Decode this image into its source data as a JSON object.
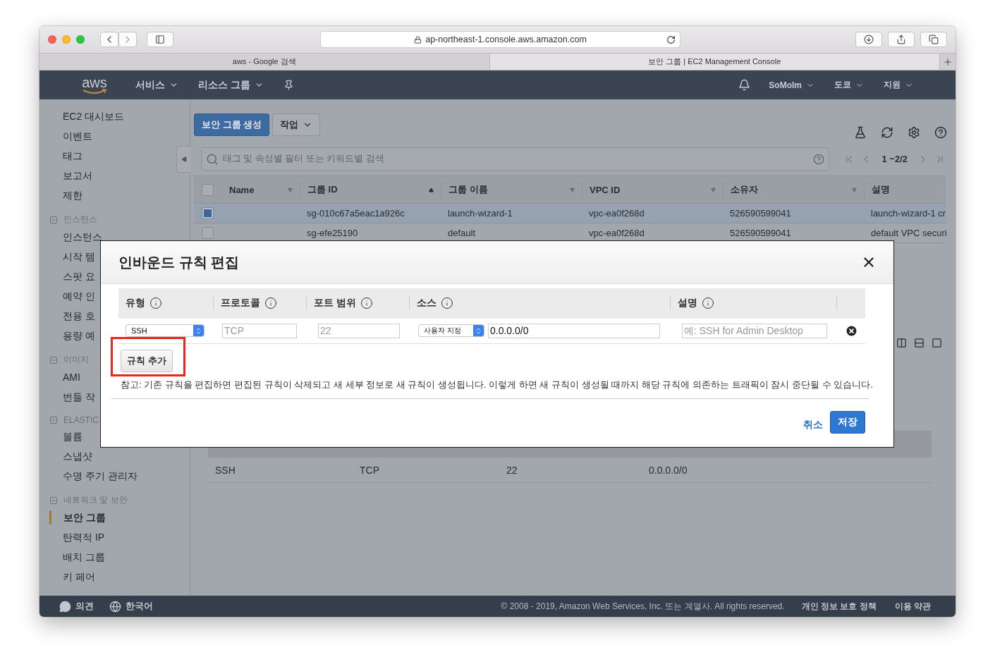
{
  "browser": {
    "url": "ap-northeast-1.console.aws.amazon.com",
    "tabs": [
      {
        "label": "aws - Google 검색",
        "selected": false
      },
      {
        "label": "보안 그룹 | EC2 Management Console",
        "selected": true
      }
    ]
  },
  "navbar": {
    "logo": "aws",
    "menus": [
      "서비스",
      "리소스 그룹"
    ],
    "user": "SoMoIm",
    "region": "도쿄",
    "support": "지원"
  },
  "sidebar": {
    "items": [
      {
        "kind": "link",
        "label": "EC2 대시보드",
        "selected": false
      },
      {
        "kind": "link",
        "label": "이벤트",
        "selected": false
      },
      {
        "kind": "link",
        "label": "태그",
        "selected": false
      },
      {
        "kind": "link",
        "label": "보고서",
        "selected": false
      },
      {
        "kind": "link",
        "label": "제한",
        "selected": false
      },
      {
        "kind": "section",
        "label": "인스턴스",
        "expanded": true
      },
      {
        "kind": "link",
        "label": "인스턴스",
        "selected": false
      },
      {
        "kind": "link",
        "label": "시작 템",
        "selected": false
      },
      {
        "kind": "link",
        "label": "스팟 요",
        "selected": false
      },
      {
        "kind": "link",
        "label": "예약 인",
        "selected": false
      },
      {
        "kind": "link",
        "label": "전용 호",
        "selected": false
      },
      {
        "kind": "link",
        "label": "용량 예",
        "selected": false
      },
      {
        "kind": "section",
        "label": "이미지",
        "expanded": true
      },
      {
        "kind": "link",
        "label": "AMI",
        "selected": false
      },
      {
        "kind": "link",
        "label": "번들 작",
        "selected": false
      },
      {
        "kind": "section",
        "label": "ELASTIC",
        "expanded": true
      },
      {
        "kind": "link",
        "label": "볼륨",
        "selected": false
      },
      {
        "kind": "link",
        "label": "스냅샷",
        "selected": false
      },
      {
        "kind": "link",
        "label": "수명 주기 관리자",
        "selected": false
      },
      {
        "kind": "section",
        "label": "네트워크 및 보안",
        "expanded": true
      },
      {
        "kind": "link",
        "label": "보안 그룹",
        "selected": true
      },
      {
        "kind": "link",
        "label": "탄력적 IP",
        "selected": false
      },
      {
        "kind": "link",
        "label": "배치 그룹",
        "selected": false
      },
      {
        "kind": "link",
        "label": "키 페어",
        "selected": false
      }
    ]
  },
  "toolbar": {
    "create_button": "보안 그룹 생성",
    "actions_button": "작업"
  },
  "search": {
    "placeholder": "태그 및 속성별 필터 또는 키워드별 검색"
  },
  "pagination": "1 ~2/2",
  "table": {
    "select_all_checked": false,
    "columns": [
      {
        "label": "Name",
        "sorted": false,
        "has_menu": true
      },
      {
        "label": "그룹 ID",
        "sorted": true,
        "has_menu": false
      },
      {
        "label": "그룹 이름",
        "sorted": false,
        "has_menu": true
      },
      {
        "label": "VPC ID",
        "sorted": false,
        "has_menu": true
      },
      {
        "label": "소유자",
        "sorted": false,
        "has_menu": true
      },
      {
        "label": "설명",
        "sorted": false,
        "has_menu": false
      }
    ],
    "rows": [
      {
        "selected": true,
        "cells": [
          "",
          "sg-010c67a5eac1a926c",
          "launch-wizard-1",
          "vpc-ea0f268d",
          "526590599041",
          "launch-wizard-1 cr"
        ]
      },
      {
        "selected": false,
        "cells": [
          "",
          "sg-efe25190",
          "default",
          "vpc-ea0f268d",
          "526590599041",
          "default VPC securi"
        ]
      }
    ]
  },
  "details": {
    "rows": [
      [
        "SSH",
        "TCP",
        "22",
        "0.0.0.0/0"
      ]
    ]
  },
  "modal": {
    "title": "인바운드 규칙 편집",
    "columns": [
      "유형",
      "프로토콜",
      "포트 범위",
      "소스",
      "설명"
    ],
    "rules": [
      {
        "type": "SSH",
        "protocol": "TCP",
        "port": "22",
        "source_mode": "사용자 지정",
        "source": "0.0.0.0/0",
        "description_placeholder": "예: SSH for Admin Desktop"
      }
    ],
    "add_rule": {
      "label": "규칙 추가",
      "highlighted": true
    },
    "note": "참고: 기존 규칙을 편집하면 편집된 규칙이 삭제되고 새 세부 정보로 새 규칙이 생성됩니다. 이렇게 하면 새 규칙이 생성될 때까지 해당 규칙에 의존하는 트래픽이 잠시 중단될 수 있습니다.",
    "cancel": "취소",
    "save": "저장"
  },
  "footer": {
    "feedback": "의견",
    "language": "한국어",
    "copyright": "© 2008 - 2019, Amazon Web Services, Inc. 또는 계열사. All rights reserved.",
    "links": [
      "개인 정보 보호 정책",
      "이용 약관"
    ]
  }
}
